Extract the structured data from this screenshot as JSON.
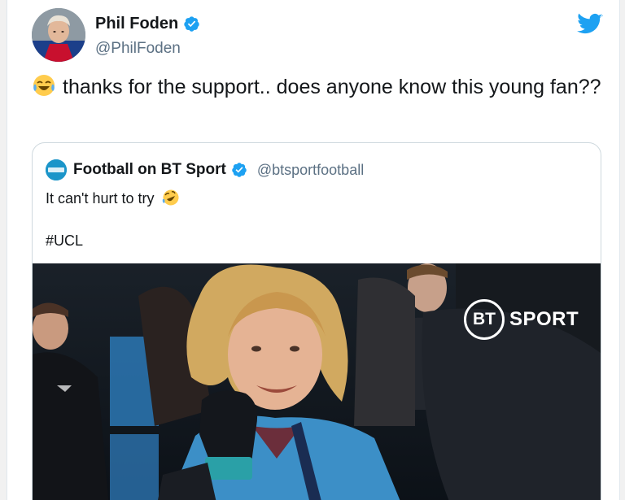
{
  "author": {
    "name": "Phil Foden",
    "handle": "@PhilFoden"
  },
  "tweet": {
    "emoji": "face-with-tears-of-joy",
    "text": "thanks for the support.. does anyone know this young fan??"
  },
  "quoted": {
    "name": "Football on BT Sport",
    "handle": "@btsportfootball",
    "text": "It can't hurt to try",
    "emoji": "rolling-on-the-floor-laughing",
    "hashtag": "#UCL"
  },
  "media": {
    "watermark_bt": "BT",
    "watermark_sport": "SPORT"
  },
  "colors": {
    "twitter_blue": "#1da1f2",
    "verified": "#1da1f2",
    "text_primary": "#14171a",
    "text_secondary": "#5b7083",
    "quote_border": "#cfd9de"
  },
  "icons": [
    "verified-badge-icon",
    "twitter-bird-icon",
    "emoji-tears-of-joy-icon",
    "emoji-rofl-icon",
    "bt-sport-logo"
  ]
}
